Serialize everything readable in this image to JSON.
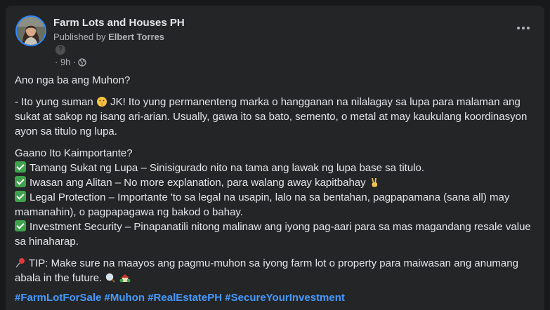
{
  "post": {
    "page_name": "Farm Lots and Houses PH",
    "published_prefix": "Published by",
    "author": "Elbert Torres",
    "help_glyph": "?",
    "time": "· 9h ·",
    "privacy_icon": "globe-icon",
    "more_icon": "more-options-icon"
  },
  "content": {
    "question": "Ano nga ba ang Muhon?",
    "answer_pre": "- Ito yung suman ",
    "answer_emoji": "shushing-face-emoji",
    "answer_post": " JK! Ito yung permanenteng marka o hangganan na nilalagay sa lupa para malaman ang sukat at sakop ng isang ari-arian. Usually, gawa ito sa bato, semento, o metal at may kaukulang koordinasyon ayon sa titulo ng lupa.",
    "importance_heading": "Gaano Ito Kaimportante?",
    "items": [
      {
        "text": "Tamang Sukat ng Lupa – Sinisigurado nito na tama ang lawak ng lupa base sa titulo."
      },
      {
        "text": "Iwasan ang Alitan – No more explanation, para walang away kapitbahay ",
        "emoji": "victory-hand-emoji"
      },
      {
        "text": "Legal  Protection – Importante 'to sa legal na usapin, lalo na sa bentahan, pagpapamana (sana all) may mamanahin), o pagpapagawa ng bakod o bahay."
      },
      {
        "text": "Investment Security – Pinapanatili nitong malinaw ang iyong pag-aari para sa mas magandang resale value sa hinaharap."
      }
    ],
    "check_icon": "check-mark-button-emoji",
    "tip_icon": "pushpin-emoji",
    "tip": " TIP: Make sure na maayos ang pagmu-muhon sa iyong farm lot o property para maiwasan ang anumang abala in the future. ",
    "tip_emojis": [
      "magnifying-glass-emoji",
      "house-with-garden-emoji"
    ],
    "hashtags": [
      "#FarmLotForSale",
      "#Muhon",
      "#RealEstatePH",
      "#SecureYourInvestment"
    ]
  },
  "colors": {
    "background": "#18191a",
    "card": "#242526",
    "text": "#e4e6eb",
    "secondary_text": "#b0b3b8",
    "link": "#4599ff",
    "avatar_ring": "#2d88ff",
    "check_green": "#3fa34d"
  }
}
